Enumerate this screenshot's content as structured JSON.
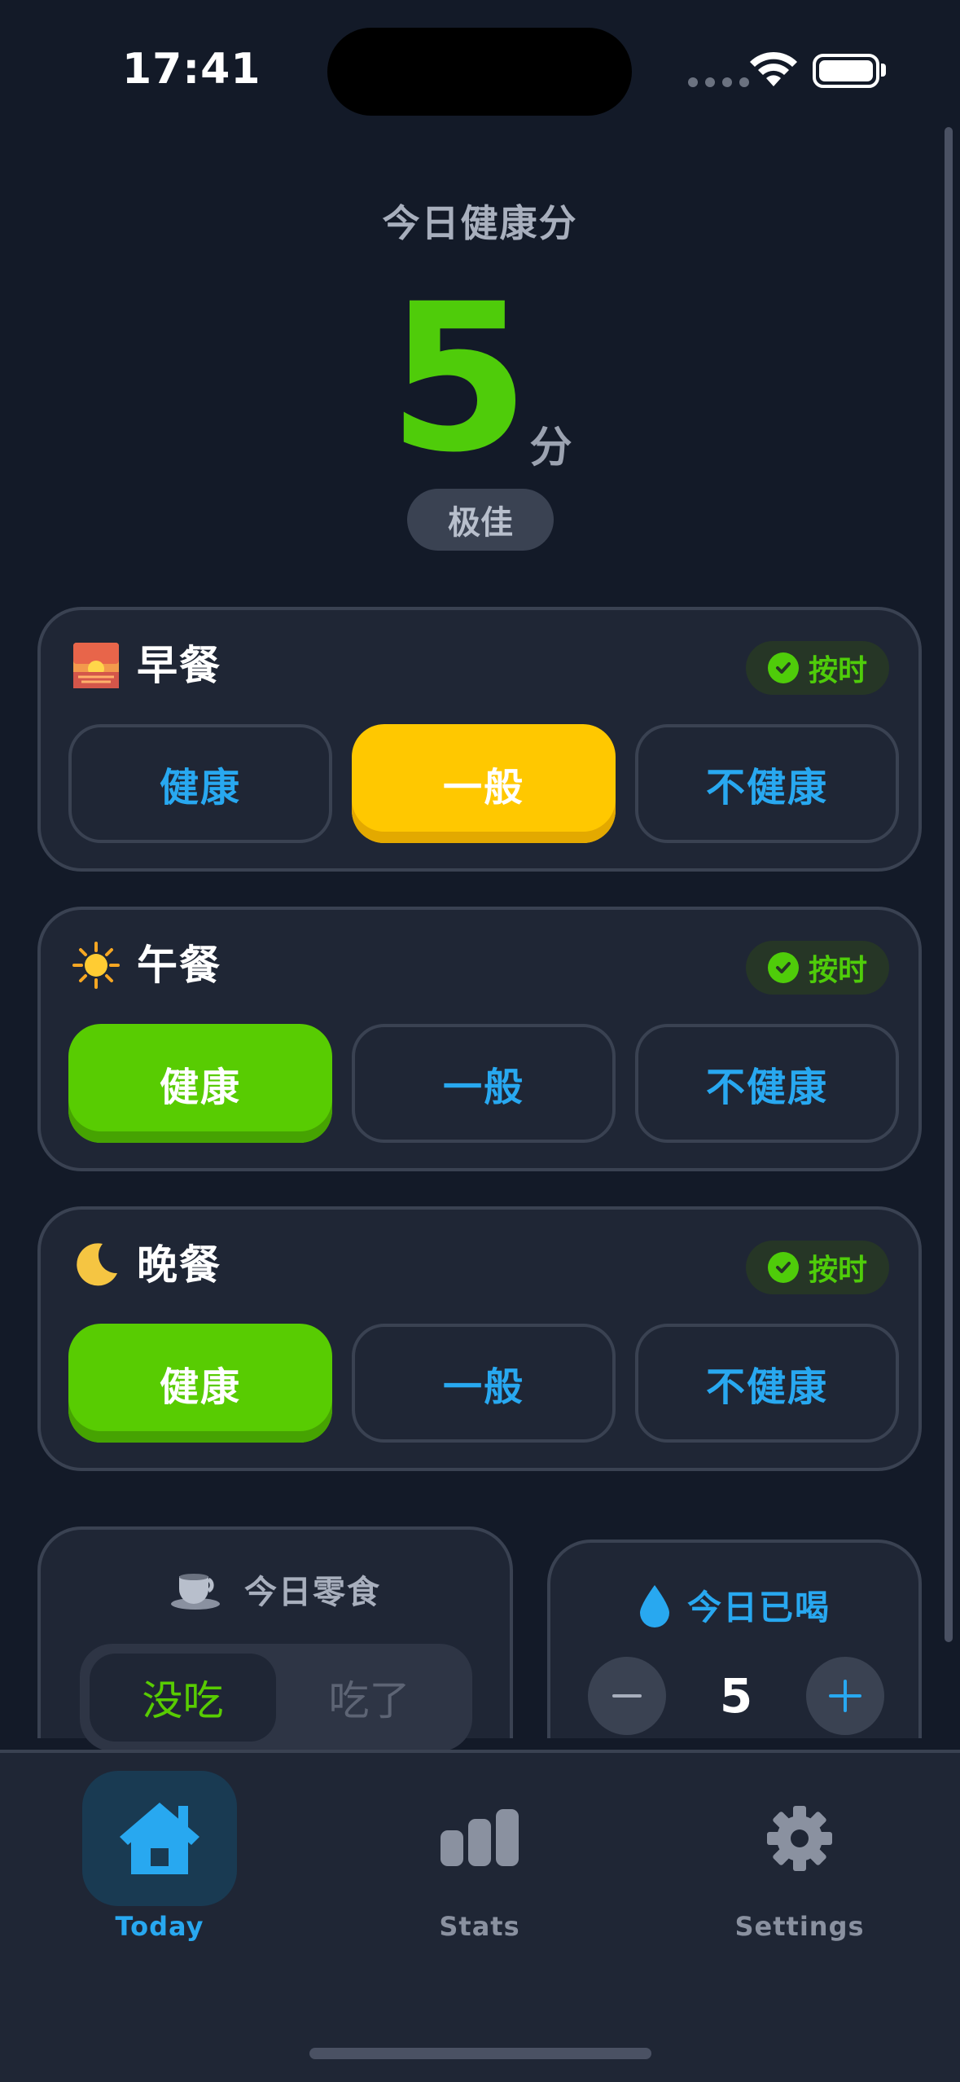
{
  "status": {
    "time": "17:41"
  },
  "score": {
    "title": "今日健康分",
    "value": "5",
    "unit": "分",
    "rating": "极佳"
  },
  "meals": [
    {
      "icon": "sunrise-icon",
      "emoji": "🌅",
      "name": "早餐",
      "ontime": "按时",
      "options": [
        "健康",
        "一般",
        "不健康"
      ],
      "selected": 1,
      "selected_color": "#ffc800"
    },
    {
      "icon": "sun-icon",
      "emoji": "☀️",
      "name": "午餐",
      "ontime": "按时",
      "options": [
        "健康",
        "一般",
        "不健康"
      ],
      "selected": 0,
      "selected_color": "#58cc02"
    },
    {
      "icon": "moon-icon",
      "emoji": "🌙",
      "name": "晚餐",
      "ontime": "按时",
      "options": [
        "健康",
        "一般",
        "不健康"
      ],
      "selected": 0,
      "selected_color": "#58cc02"
    }
  ],
  "snack": {
    "icon": "cup-icon",
    "title": "今日零食",
    "options": [
      "没吃",
      "吃了"
    ],
    "selected": 0
  },
  "water": {
    "icon": "drop-icon",
    "title": "今日已喝",
    "count": "5"
  },
  "tabs": [
    {
      "label": "Today",
      "icon": "home-icon",
      "active": true
    },
    {
      "label": "Stats",
      "icon": "bar-chart-icon",
      "active": false
    },
    {
      "label": "Settings",
      "icon": "gear-icon",
      "active": false
    }
  ],
  "colors": {
    "accent_blue": "#28a8f0",
    "accent_green": "#58cc02",
    "accent_yellow": "#ffc800",
    "background": "#131a28",
    "card": "#1f2635"
  }
}
